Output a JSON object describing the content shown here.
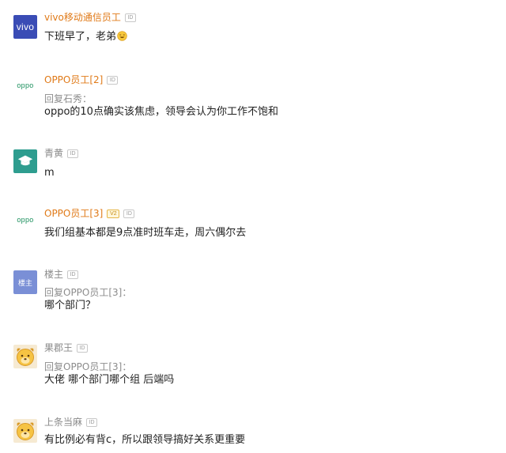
{
  "comments": [
    {
      "username": "vivo移动通信员工",
      "avatar_text": "vivo",
      "badge": "ID",
      "text": "下班早了，老弟",
      "emoji": "smile-emoji",
      "name_color": "#e07a18"
    },
    {
      "username": "OPPO员工[2]",
      "avatar_text": "oppo",
      "badge": "ID",
      "reply_to": "回复石秀：",
      "text": "oppo的10点确实该焦虑，领导会认为你工作不饱和",
      "name_color": "#e07a18"
    },
    {
      "username": "青黄",
      "badge": "ID",
      "text": "m",
      "avatar_icon": "graduation-cap-icon",
      "name_color": "#8a8a8a"
    },
    {
      "username": "OPPO员工[3]",
      "avatar_text": "oppo",
      "vip_badge": "V2",
      "badge": "ID",
      "text": "我们组基本都是9点准时班车走，周六偶尔去",
      "name_color": "#e07a18"
    },
    {
      "username": "楼主",
      "avatar_text": "楼主",
      "badge": "ID",
      "reply_to": "回复OPPO员工[3]：",
      "text": "哪个部门？",
      "name_color": "#8a8a8a"
    },
    {
      "username": "果郡王",
      "badge": "ID",
      "reply_to": "回复OPPO员工[3]：",
      "text": "大佬 哪个部门哪个组 后端吗",
      "avatar_icon": "dog-face-icon",
      "name_color": "#8a8a8a"
    },
    {
      "username": "上条当麻",
      "badge": "ID",
      "text": "有比例必有背c，所以跟领导搞好关系更重要",
      "avatar_icon": "dog-face-icon",
      "name_color": "#8a8a8a"
    }
  ]
}
